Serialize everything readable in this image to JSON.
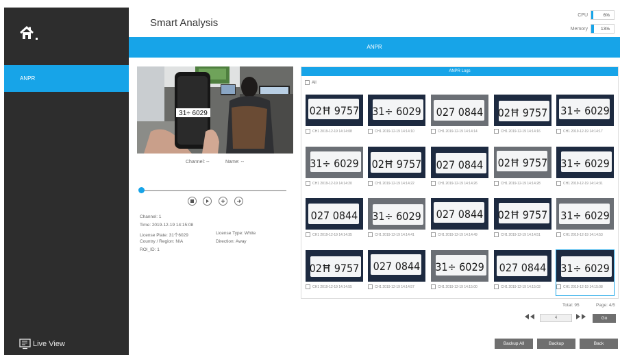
{
  "header": {
    "title": "Smart Analysis"
  },
  "system": {
    "cpu_label": "CPU",
    "cpu_value": "6%",
    "cpu_fraction": 0.06,
    "memory_label": "Memory",
    "memory_value": "13%",
    "memory_fraction": 0.13
  },
  "sidebar": {
    "home_icon": "home-icon",
    "items": [
      {
        "label": "ANPR",
        "active": true
      }
    ],
    "live_view_label": "Live View"
  },
  "banner": {
    "title": "ANPR"
  },
  "player": {
    "channel_label": "Channel: --",
    "name_label": "Name: --",
    "video_plate": "31÷ 6029",
    "progress_fraction": 0.0
  },
  "details": {
    "channel": "Channel: 1",
    "time": "Time: 2019-12-19 14:15:08",
    "license_plate": "License Plate: 31个6029",
    "license_type": "License Type: White",
    "country": "Country / Region: N/A",
    "direction": "Direction: Away",
    "roi": "ROI_ID: 1"
  },
  "logs": {
    "title": "ANPR Logs",
    "all_label": "All",
    "items": [
      {
        "plate": "02Ħ 9757",
        "caption": "CH1 2019-12-19 14:14:08"
      },
      {
        "plate": "31÷ 6029",
        "caption": "CH1 2019-12-19 14:14:10"
      },
      {
        "plate": "027 0844",
        "caption": "CH1 2019-12-19 14:14:14"
      },
      {
        "plate": "02Ħ 9757",
        "caption": "CH1 2019-12-19 14:14:16"
      },
      {
        "plate": "31÷ 6029",
        "caption": "CH1 2019-12-19 14:14:17"
      },
      {
        "plate": "31÷ 6029",
        "caption": "CH1 2019-12-19 14:14:20"
      },
      {
        "plate": "02Ħ 9757",
        "caption": "CH1 2019-12-19 14:14:22"
      },
      {
        "plate": "027 0844",
        "caption": "CH1 2019-12-19 14:14:26"
      },
      {
        "plate": "02Ħ 9757",
        "caption": "CH1 2019-12-19 14:14:28"
      },
      {
        "plate": "31÷ 6029",
        "caption": "CH1 2019-12-19 14:14:31"
      },
      {
        "plate": "027 0844",
        "caption": "CH1 2019-12-19 14:14:35"
      },
      {
        "plate": "31÷ 6029",
        "caption": "CH1 2019-12-19 14:14:41"
      },
      {
        "plate": "027 0844",
        "caption": "CH1 2019-12-19 14:14:49"
      },
      {
        "plate": "02Ħ 9757",
        "caption": "CH1 2019-12-19 14:14:51"
      },
      {
        "plate": "31÷ 6029",
        "caption": "CH1 2019-12-19 14:14:53"
      },
      {
        "plate": "02Ħ 9757",
        "caption": "CH1 2019-12-19 14:14:55"
      },
      {
        "plate": "027 0844",
        "caption": "CH1 2019-12-19 14:14:57"
      },
      {
        "plate": "31÷ 6029",
        "caption": "CH1 2019-12-19 14:15:00"
      },
      {
        "plate": "027 0844",
        "caption": "CH1 2019-12-19 14:15:03"
      },
      {
        "plate": "31÷ 6029",
        "caption": "CH1 2019-12-19 14:15:08",
        "selected": true
      }
    ]
  },
  "pagination": {
    "total": "Total: 95",
    "page": "Page: 4/5",
    "current_page": "4",
    "go_label": "Go"
  },
  "actions": {
    "backup_all": "Backup All",
    "backup": "Backup",
    "back": "Back"
  },
  "colors": {
    "accent": "#17a4e8",
    "sidebar": "#2d2d2d",
    "button": "#6f6f6f"
  }
}
